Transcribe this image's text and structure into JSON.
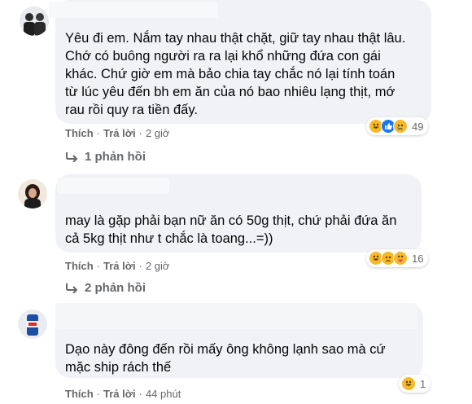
{
  "comments": [
    {
      "text_lines": [
        "Yêu đi em. Nắm tay nhau thật chặt, giữ tay nhau thật lâu.",
        "Chớ có buông người ra ra lại khổ những đứa con gái",
        "khác. Chứ giờ em mà bảo chia tay chắc nó lại tính toán",
        "từ lúc yêu đến bh em ăn của nó bao nhiêu lạng thịt, mớ",
        "rau rồi quy ra tiền đấy."
      ],
      "like": "Thích",
      "reply": "Trả lời",
      "time": "2 giờ",
      "reaction_count": "49",
      "replies_label": "1 phản hồi",
      "reaction_icons": [
        "haha-icon",
        "like-icon",
        "sad-icon"
      ]
    },
    {
      "text_lines": [
        "may là gặp phải bạn nữ ăn có 50g thịt, chứ phải đứa ăn",
        "cả 5kg thịt như t chắc là toang...=))"
      ],
      "like": "Thích",
      "reply": "Trả lời",
      "time": "2 giờ",
      "reaction_count": "16",
      "replies_label": "2 phản hồi",
      "reaction_icons": [
        "haha-icon",
        "sad-icon",
        "care-icon"
      ]
    },
    {
      "text_lines": [
        "Dạo này đông đến rồi mấy ông không lạnh sao mà cứ",
        "mặc ship rách thế"
      ],
      "like": "Thích",
      "reply": "Trả lời",
      "time": "44 phút",
      "reaction_count": "1",
      "reaction_icons": [
        "haha-icon"
      ]
    }
  ],
  "separator": "·",
  "colors": {
    "bubble": "#f0f2f5",
    "secondary_text": "#65676b",
    "like_blue": "#1877f2",
    "haha_yellow": "#f7b928"
  }
}
